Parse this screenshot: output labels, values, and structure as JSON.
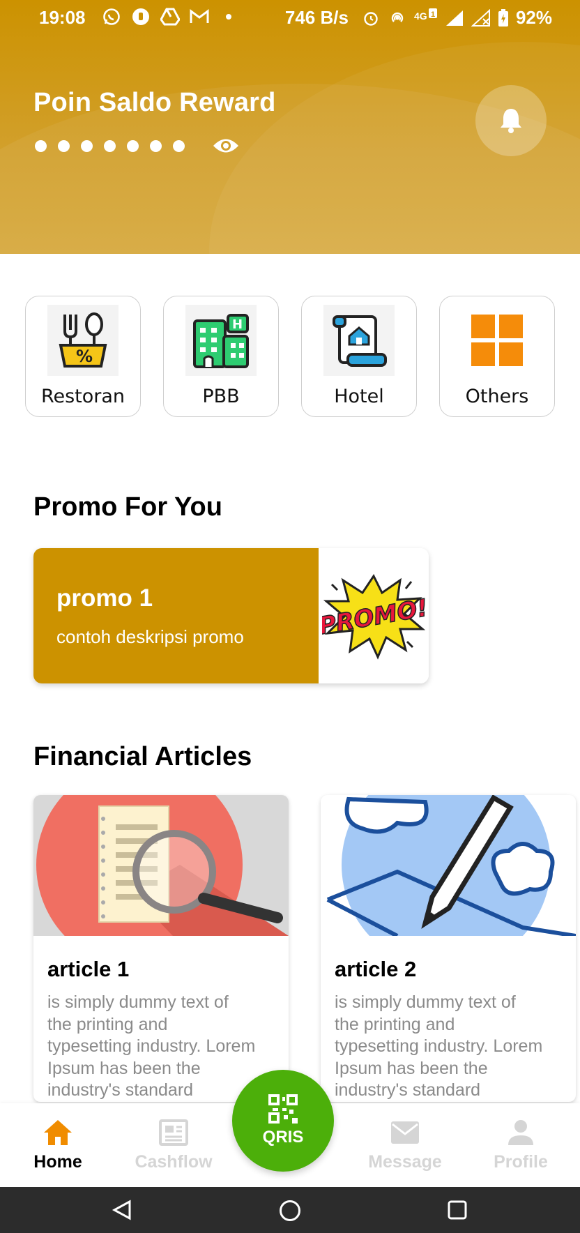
{
  "status_bar": {
    "time": "19:08",
    "network_speed": "746 B/s",
    "battery": "92%",
    "left_icons": [
      "whatsapp-icon",
      "app-icon",
      "drive-icon",
      "gmail-icon",
      "dot-icon"
    ],
    "right_icons": [
      "alarm-icon",
      "hotspot-icon",
      "4g-icon",
      "signal-icon",
      "signal-2-icon",
      "battery-icon"
    ]
  },
  "header": {
    "title": "Poin Saldo Reward",
    "masked_dots": 7,
    "bg_color": "#cc9200"
  },
  "categories": [
    {
      "label": "Restoran",
      "icon": "restaurant-icon"
    },
    {
      "label": "PBB",
      "icon": "building-icon"
    },
    {
      "label": "Hotel",
      "icon": "hotel-icon"
    },
    {
      "label": "Others",
      "icon": "grid-icon"
    }
  ],
  "promo_section": {
    "title": "Promo For You",
    "cards": [
      {
        "title": "promo 1",
        "description": "contoh deskripsi promo",
        "badge_text": "PROMO!"
      }
    ]
  },
  "articles_section": {
    "title": "Financial Articles",
    "cards": [
      {
        "title": "article 1",
        "text": "is simply dummy text of the printing and typesetting industry. Lorem Ipsum has been the industry's standard"
      },
      {
        "title": "article 2",
        "text": "is simply dummy text of the printing and typesetting industry. Lorem Ipsum has been the industry's standard"
      }
    ]
  },
  "bottom_nav": {
    "items": [
      {
        "label": "Home",
        "icon": "home-icon",
        "active": true
      },
      {
        "label": "Cashflow",
        "icon": "newspaper-icon",
        "active": false
      },
      {
        "label": "Message",
        "icon": "mail-icon",
        "active": false
      },
      {
        "label": "Profile",
        "icon": "person-icon",
        "active": false
      }
    ],
    "center_button": {
      "label": "QRIS",
      "icon": "qr-icon",
      "color": "#4caf0a"
    },
    "active_color": "#f08c00"
  }
}
